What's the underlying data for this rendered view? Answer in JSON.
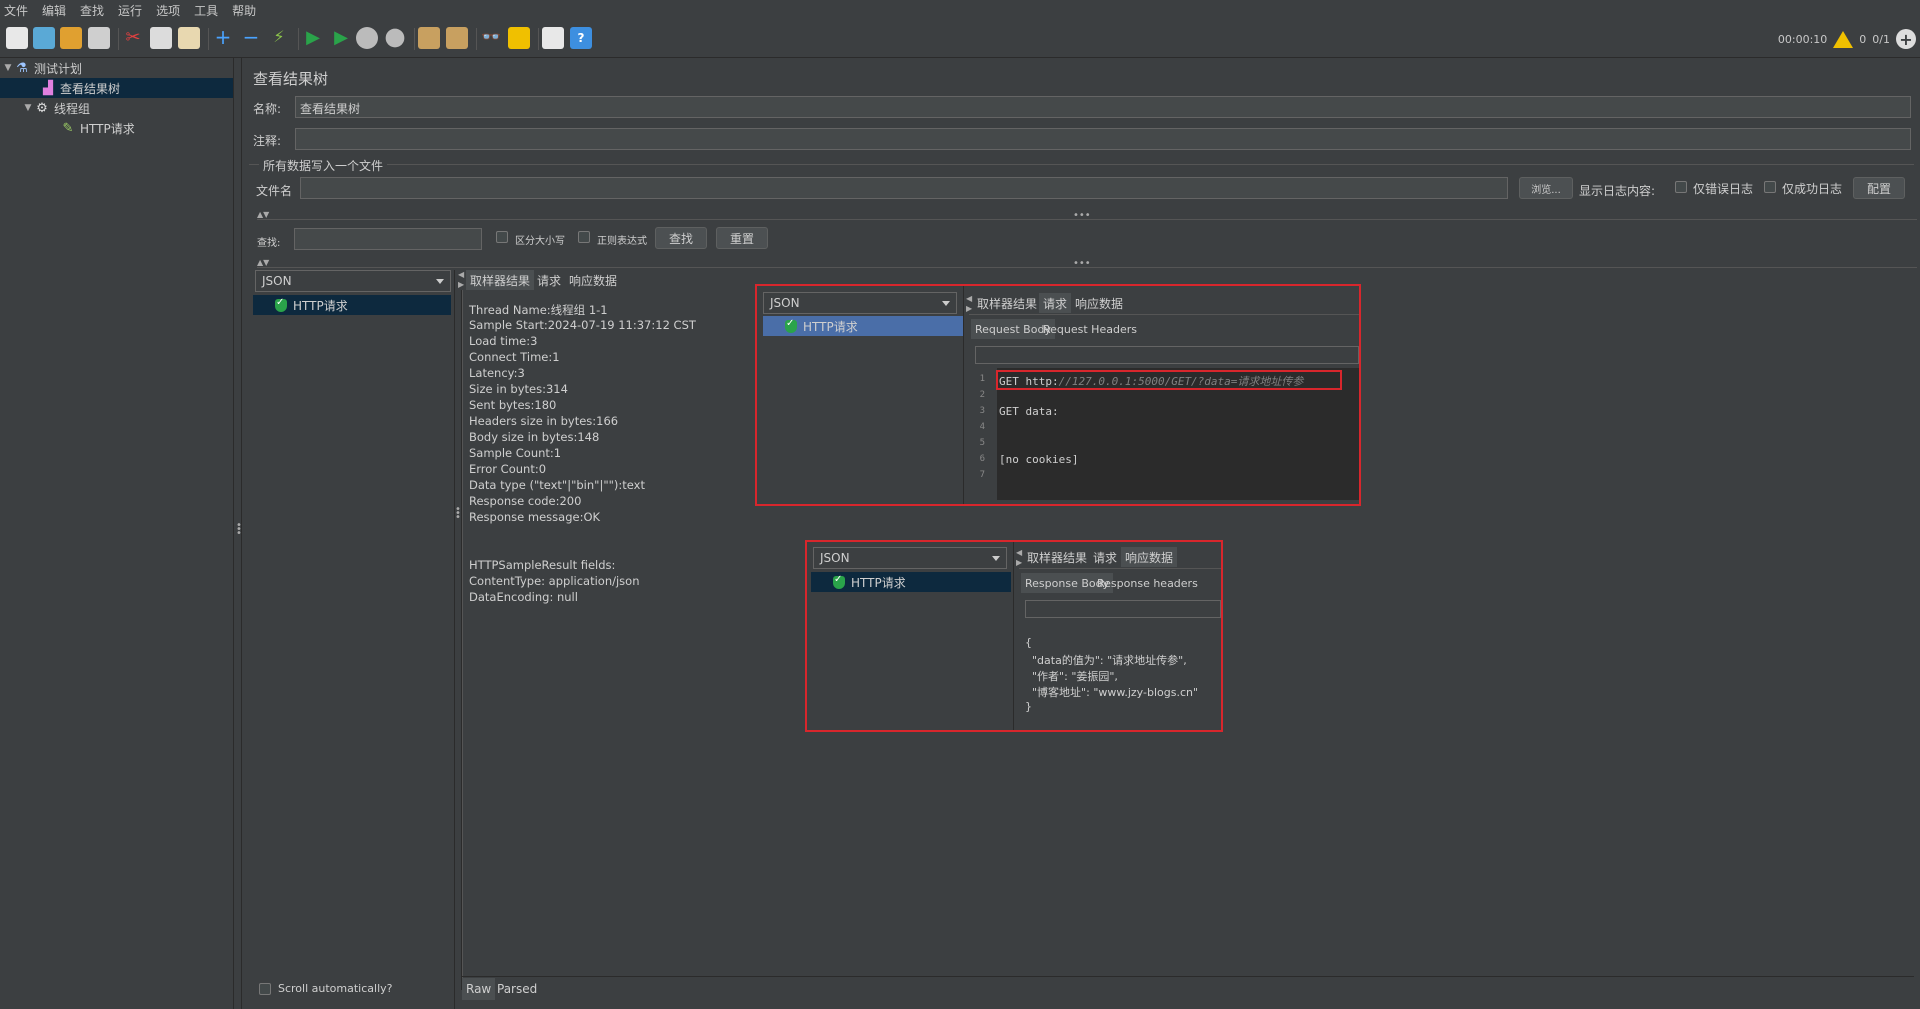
{
  "menu": [
    "文件",
    "编辑",
    "查找",
    "运行",
    "选项",
    "工具",
    "帮助"
  ],
  "status": {
    "elapsed": "00:00:10",
    "warnings": "0",
    "threads": "0/1"
  },
  "tree": {
    "test_plan": "测试计划",
    "view_results_tree": "查看结果树",
    "thread_group": "线程组",
    "http_request": "HTTP请求"
  },
  "panel": {
    "title": "查看结果树",
    "name_label": "名称:",
    "name_value": "查看结果树",
    "comment_label": "注释:",
    "comment_value": "",
    "write_all_label": "所有数据写入一个文件",
    "filename_label": "文件名",
    "filename_value": "",
    "browse": "浏览...",
    "log_display_label": "显示日志内容:",
    "errors_only": "仅错误日志",
    "success_only": "仅成功日志",
    "configure": "配置"
  },
  "search": {
    "label": "查找:",
    "value": "",
    "case_sensitive": "区分大小写",
    "regex": "正则表达式",
    "find": "查找",
    "reset": "重置"
  },
  "results": {
    "renderer": "JSON",
    "item": "HTTP请求",
    "tabs": [
      "取样器结果",
      "请求",
      "响应数据"
    ],
    "sampler_lines": [
      "Thread Name:线程组 1-1",
      "Sample Start:2024-07-19 11:37:12 CST",
      "Load time:3",
      "Connect Time:1",
      "Latency:3",
      "Size in bytes:314",
      "Sent bytes:180",
      "Headers size in bytes:166",
      "Body size in bytes:148",
      "Sample Count:1",
      "Error Count:0",
      "Data type (\"text\"|\"bin\"|\"\"):text",
      "Response code:200",
      "Response message:OK"
    ],
    "fields_lines": [
      "HTTPSampleResult fields:",
      "ContentType: application/json",
      "DataEncoding: null"
    ],
    "scroll_auto": "Scroll automatically?",
    "bottom_tabs": [
      "Raw",
      "Parsed"
    ]
  },
  "overlay_request": {
    "renderer": "JSON",
    "item": "HTTP请求",
    "tabs": [
      "取样器结果",
      "请求",
      "响应数据"
    ],
    "subtabs": [
      "Request Body",
      "Request Headers"
    ],
    "line_numbers": [
      "1",
      "2",
      "3",
      "4",
      "5",
      "6",
      "7"
    ],
    "code_get": "GET http:",
    "code_url": "//127.0.0.1:5000/GET/?data=请求地址传参",
    "code_data": "GET data:",
    "code_cookies": "[no cookies]"
  },
  "overlay_response": {
    "renderer": "JSON",
    "item": "HTTP请求",
    "tabs": [
      "取样器结果",
      "请求",
      "响应数据"
    ],
    "subtabs": [
      "Response Body",
      "Response headers"
    ],
    "body_lines": [
      "{",
      "  \"data的值为\": \"请求地址传参\",",
      "  \"作者\": \"姜振园\",",
      "  \"博客地址\": \"www.jzy-blogs.cn\"",
      "}"
    ]
  },
  "colors": {
    "accent": "#d8262c",
    "success": "#2aa34a",
    "selection": "#0d293e",
    "selection_light": "#4a6ea8"
  }
}
